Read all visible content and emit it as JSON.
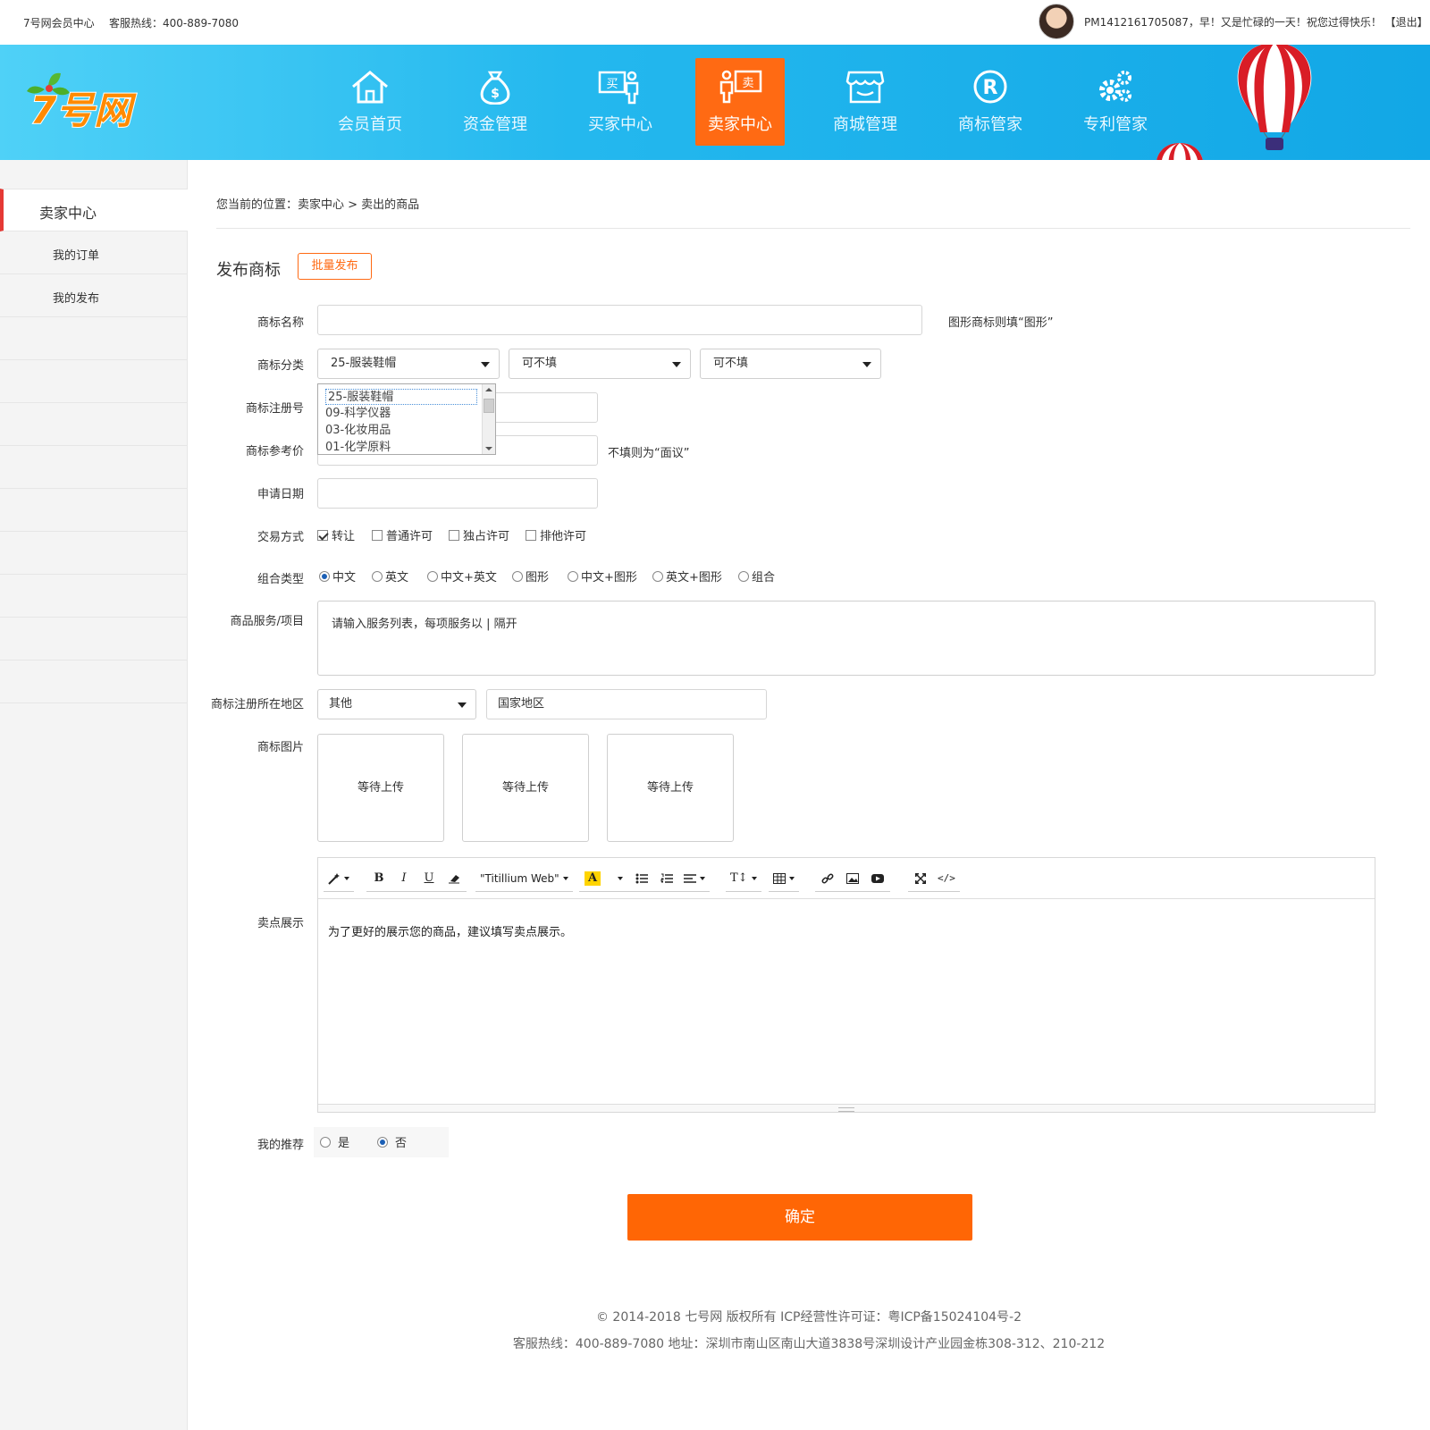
{
  "topbar": {
    "site": "7号网会员中心",
    "hotline": "客服热线：400-889-7080",
    "greeting": "PM1412161705087，早！又是忙碌的一天！祝您过得快乐！",
    "logout": "【退出】"
  },
  "logo": {
    "text": "7号网"
  },
  "nav": [
    {
      "label": "会员首页",
      "icon": "home-icon"
    },
    {
      "label": "资金管理",
      "icon": "money-bag-icon"
    },
    {
      "label": "买家中心",
      "icon": "buyer-icon",
      "badge": "买"
    },
    {
      "label": "卖家中心",
      "icon": "seller-icon",
      "badge": "卖",
      "active": true
    },
    {
      "label": "商城管理",
      "icon": "store-icon"
    },
    {
      "label": "商标管家",
      "icon": "registered-icon"
    },
    {
      "label": "专利管家",
      "icon": "gears-icon"
    }
  ],
  "sidebar": {
    "head": "卖家中心",
    "items": [
      "我的订单",
      "我的发布"
    ]
  },
  "breadcrumb": "您当前的位置：卖家中心 > 卖出的商品",
  "form": {
    "title": "发布商标",
    "batch_button": "批量发布",
    "name_label": "商标名称",
    "name_value": "",
    "name_hint": "图形商标则填“图形”",
    "category_label": "商标分类",
    "category_value": "25-服装鞋帽",
    "category_sub1": "可不填",
    "category_sub2": "可不填",
    "category_options": [
      "25-服装鞋帽",
      "09-科学仪器",
      "03-化妆用品",
      "01-化学原料"
    ],
    "reg_no_label": "商标注册号",
    "price_label": "商标参考价",
    "price_hint": "不填则为“面议”",
    "date_label": "申请日期",
    "trade_label": "交易方式",
    "trade_options": [
      {
        "label": "转让",
        "checked": true
      },
      {
        "label": "普通许可",
        "checked": false
      },
      {
        "label": "独占许可",
        "checked": false
      },
      {
        "label": "排他许可",
        "checked": false
      }
    ],
    "combo_label": "组合类型",
    "combo_options": [
      {
        "label": "中文",
        "checked": true
      },
      {
        "label": "英文",
        "checked": false
      },
      {
        "label": "中文+英文",
        "checked": false
      },
      {
        "label": "图形",
        "checked": false
      },
      {
        "label": "中文+图形",
        "checked": false
      },
      {
        "label": "英文+图形",
        "checked": false
      },
      {
        "label": "组合",
        "checked": false
      }
    ],
    "services_label": "商品服务/项目",
    "services_placeholder": "请输入服务列表，每项服务以 | 隔开",
    "region_label": "商标注册所在地区",
    "region_value": "其他",
    "country_placeholder": "国家地区",
    "image_label": "商标图片",
    "upload_text": [
      "等待上传",
      "等待上传",
      "等待上传"
    ],
    "selling_label": "卖点展示",
    "editor_font": "\"Titillium Web\"",
    "editor_text": "为了更好的展示您的商品，建议填写卖点展示。",
    "recommend_label": "我的推荐",
    "recommend_yes": "是",
    "recommend_no": "否",
    "recommend_value": "否",
    "submit": "确定"
  },
  "footer": {
    "line1": "© 2014-2018 七号网 版权所有 ICP经营性许可证：粤ICP备15024104号-2",
    "line2": "客服热线：400-889-7080  地址：深圳市南山区南山大道3838号深圳设计产业园金栋308-312、210-212"
  },
  "colors": {
    "accent": "#ff6a13",
    "header": "#12a7e6",
    "sidebar_marker": "#e53935"
  }
}
